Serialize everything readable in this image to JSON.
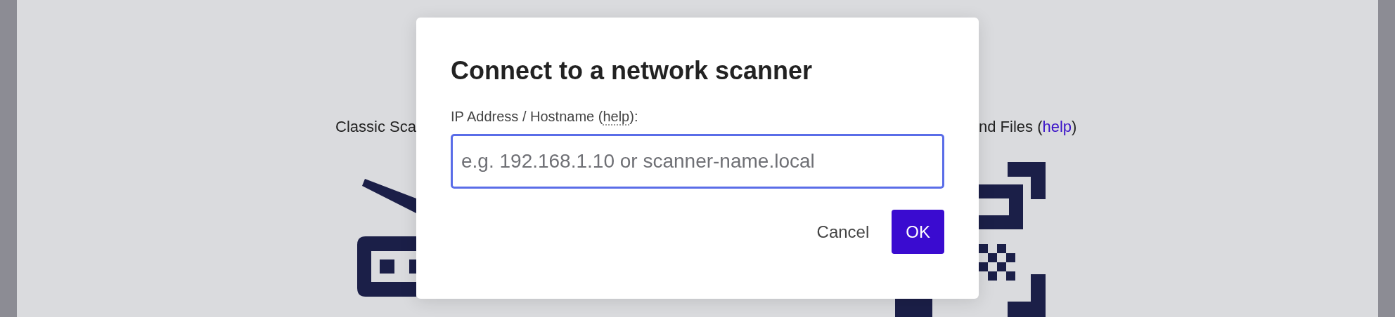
{
  "background": {
    "left_option": "Classic Sca",
    "right_option": {
      "prefix": "nd Files (",
      "link": "help",
      "suffix": ")"
    }
  },
  "dialog": {
    "title": "Connect to a network scanner",
    "field": {
      "label_prefix": "IP Address / Hostname (",
      "label_help": "help",
      "label_suffix": "):",
      "placeholder": "e.g. 192.168.1.10 or scanner-name.local",
      "focused": true
    },
    "buttons": [
      {
        "label": "Cancel",
        "kind": "secondary"
      },
      {
        "label": "OK",
        "kind": "primary"
      }
    ]
  }
}
